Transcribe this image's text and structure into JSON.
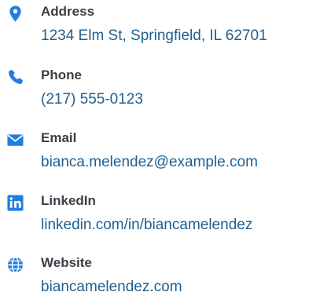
{
  "accent_color": "#1e7fe0",
  "contacts": [
    {
      "icon": "location-pin-icon",
      "label": "Address",
      "value": "1234 Elm St, Springfield, IL 62701"
    },
    {
      "icon": "phone-icon",
      "label": "Phone",
      "value": "(217) 555-0123"
    },
    {
      "icon": "envelope-icon",
      "label": "Email",
      "value": "bianca.melendez@example.com"
    },
    {
      "icon": "linkedin-icon",
      "label": "LinkedIn",
      "value": "linkedin.com/in/biancamelendez"
    },
    {
      "icon": "globe-icon",
      "label": "Website",
      "value": "biancamelendez.com"
    }
  ]
}
